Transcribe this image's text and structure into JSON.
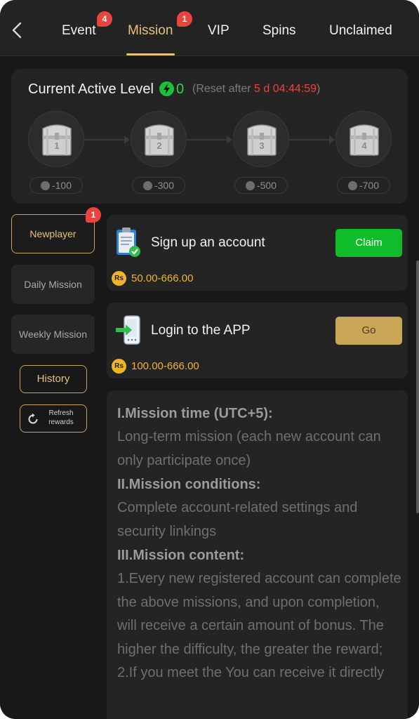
{
  "colors": {
    "accent_gold": "#e6c27a",
    "badge_red": "#e8453c",
    "claim_green": "#0fbd2a",
    "go_gold": "#c9a757",
    "energy_green": "#2ed34e",
    "reward_gold": "#f0b429"
  },
  "nav": {
    "back_icon": "chevron-left-icon",
    "tabs": [
      {
        "label": "Event",
        "badge": "4",
        "active": false
      },
      {
        "label": "Mission",
        "badge": "1",
        "active": true
      },
      {
        "label": "VIP",
        "badge": "",
        "active": false
      },
      {
        "label": "Spins",
        "badge": "",
        "active": false
      },
      {
        "label": "Unclaimed",
        "badge": "",
        "active": false
      }
    ]
  },
  "level": {
    "title": "Current Active Level",
    "value": "0",
    "reset_prefix": "(Reset after ",
    "reset_time": "5 d 04:44:59",
    "reset_suffix": ")",
    "chests": [
      {
        "num": "1",
        "points": "-100"
      },
      {
        "num": "2",
        "points": "-300"
      },
      {
        "num": "3",
        "points": "-500"
      },
      {
        "num": "4",
        "points": "-700"
      }
    ]
  },
  "sidebar": {
    "newplayer": {
      "label": "Newplayer",
      "badge": "1"
    },
    "daily": {
      "label": "Daily Mission"
    },
    "weekly": {
      "label": "Weekly Mission"
    },
    "history": {
      "label": "History"
    },
    "refresh": {
      "label_line1": "Refresh",
      "label_line2": "rewards"
    }
  },
  "missions": [
    {
      "title": "Sign up an account",
      "currency": "Rs",
      "reward": "50.00-666.00",
      "action": "Claim",
      "icon": "clipboard-check-icon"
    },
    {
      "title": "Login to the APP",
      "currency": "Rs",
      "reward": "100.00-666.00",
      "action": "Go",
      "icon": "phone-login-icon"
    }
  ],
  "rules": {
    "h1": "I.Mission time (UTC+5):",
    "p1": "Long-term mission (each new account can only participate once)",
    "h2": "II.Mission conditions:",
    "p2": "Complete account-related settings and security linkings",
    "h3": "III.Mission content:",
    "p3": "1.Every new registered account can complete the above missions, and upon completion, will receive a certain amount of bonus. The higher the difficulty, the greater the reward;",
    "p4": "2.If you meet the You can receive it directly"
  }
}
